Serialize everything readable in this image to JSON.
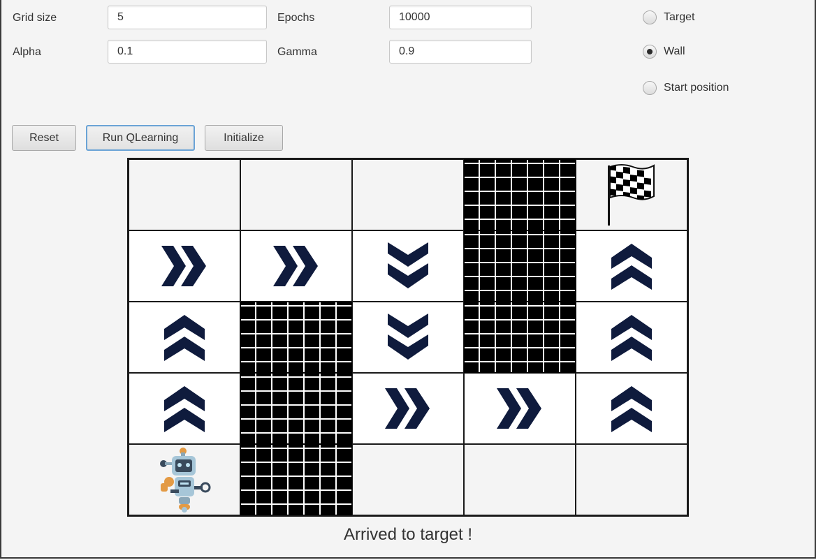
{
  "params": {
    "grid_size": {
      "label": "Grid size",
      "value": "5"
    },
    "epochs": {
      "label": "Epochs",
      "value": "10000"
    },
    "alpha": {
      "label": "Alpha",
      "value": "0.1"
    },
    "gamma": {
      "label": "Gamma",
      "value": "0.9"
    }
  },
  "mode": {
    "options": [
      {
        "label": "Target",
        "selected": false
      },
      {
        "label": "Wall",
        "selected": true
      },
      {
        "label": "Start position",
        "selected": false
      }
    ]
  },
  "buttons": {
    "reset": "Reset",
    "run": "Run QLearning",
    "initialize": "Initialize"
  },
  "grid": {
    "size": 5,
    "cells": [
      [
        "empty",
        "empty",
        "empty",
        "wall",
        "target"
      ],
      [
        "right",
        "right",
        "down",
        "wall",
        "up"
      ],
      [
        "up",
        "wall",
        "down",
        "wall",
        "up"
      ],
      [
        "up",
        "wall",
        "right",
        "right",
        "up"
      ],
      [
        "agent",
        "wall",
        "empty",
        "empty",
        "empty"
      ]
    ],
    "icons": {
      "right": "double-chevron-right-icon",
      "down": "double-chevron-down-icon",
      "up": "double-chevron-up-icon",
      "target": "checkered-flag-icon",
      "agent": "robot-icon",
      "wall": "brick-wall"
    },
    "arrow_color": "#0f1b3d"
  },
  "status": "Arrived to target !"
}
